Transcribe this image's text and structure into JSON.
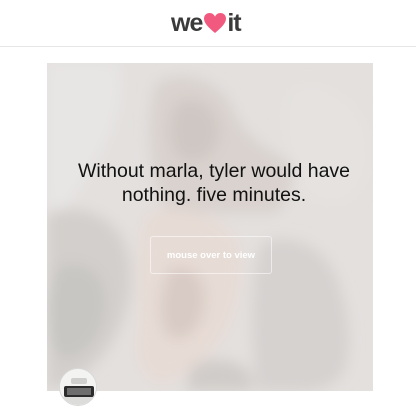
{
  "header": {
    "logo_left": "we",
    "logo_right": "it",
    "heart_color": "#f2597f"
  },
  "card": {
    "quote": "Without marla, tyler would have nothing. five minutes.",
    "reveal_label": "mouse over to view"
  },
  "user": {
    "avatar_icon": "user-avatar"
  }
}
